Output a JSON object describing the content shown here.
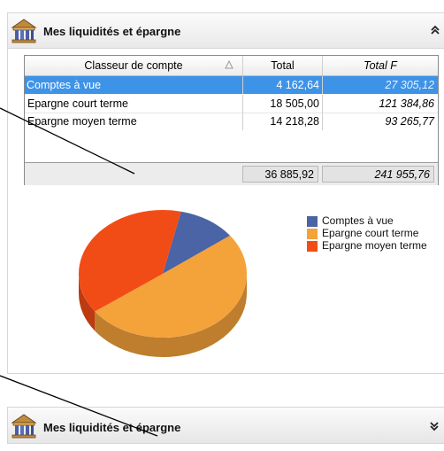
{
  "panel": {
    "title": "Mes liquidités et épargne",
    "icon": "bank-building-icon",
    "collapse_icon": "double-chevron-up-icon"
  },
  "table": {
    "columns": [
      "Classeur de compte",
      "Total",
      "Total F"
    ],
    "sort_icon": "sort-triangle-icon",
    "rows": [
      {
        "name": "Comptes à vue",
        "total": "4 162,64",
        "total_f": "27 305,12",
        "selected": true
      },
      {
        "name": "Epargne court terme",
        "total": "18 505,00",
        "total_f": "121 384,86"
      },
      {
        "name": "Epargne moyen terme",
        "total": "14 218,28",
        "total_f": "93 265,77"
      }
    ],
    "footer": {
      "total": "36 885,92",
      "total_f": "241 955,76"
    }
  },
  "chart_data": {
    "type": "pie",
    "title": "",
    "categories": [
      "Comptes à vue",
      "Epargne court terme",
      "Epargne moyen terme"
    ],
    "values": [
      4162.64,
      18505.0,
      14218.28
    ],
    "colors": [
      "#4a64a5",
      "#f4a23a",
      "#f24c16"
    ],
    "legend_position": "right"
  },
  "collapsed_panel": {
    "title": "Mes liquidités et épargne",
    "icon": "bank-building-icon",
    "expand_icon": "double-chevron-down-icon"
  },
  "colors": {
    "selection": "#3d93e7",
    "header_bg": "#ececec"
  }
}
